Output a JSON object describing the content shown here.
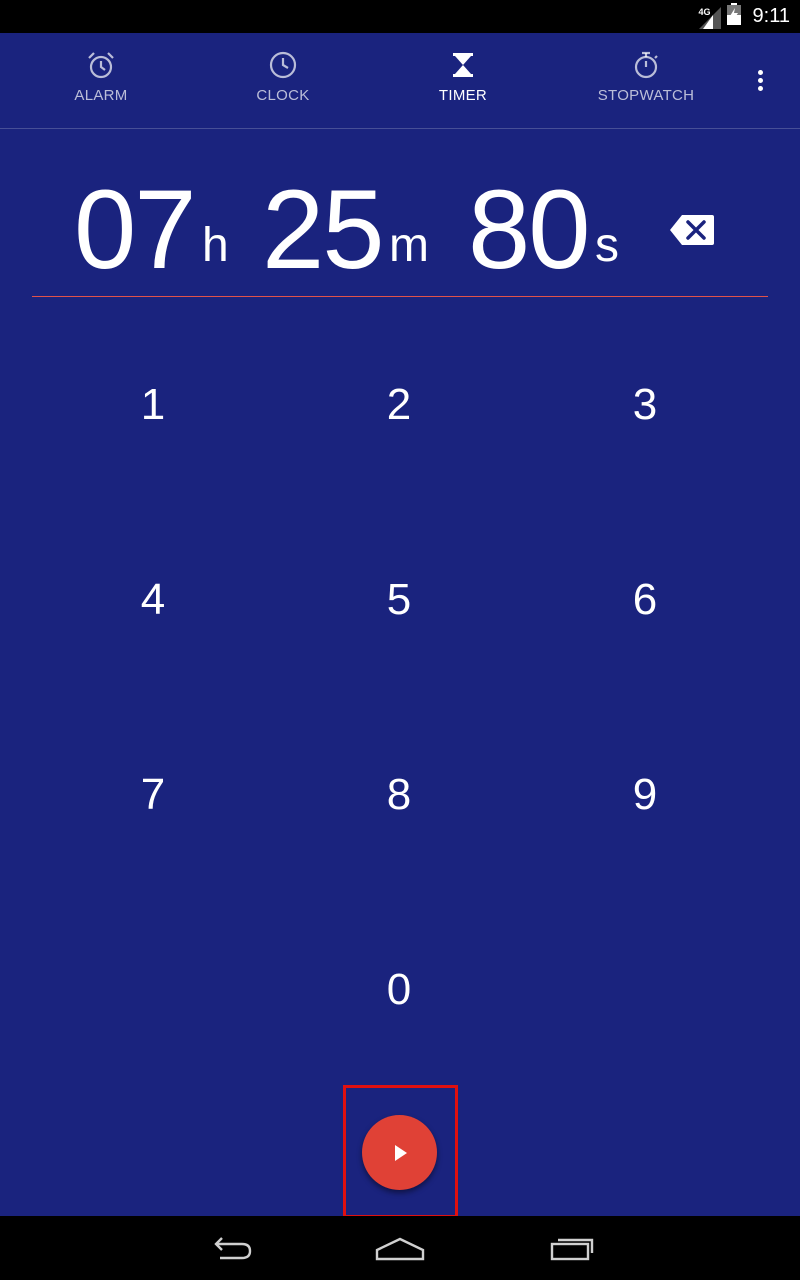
{
  "status_bar": {
    "network": "4G",
    "time": "9:11"
  },
  "tabs": [
    {
      "label": "ALARM",
      "icon": "alarm-icon",
      "active": false
    },
    {
      "label": "CLOCK",
      "icon": "clock-icon",
      "active": false
    },
    {
      "label": "TIMER",
      "icon": "hourglass-icon",
      "active": true
    },
    {
      "label": "STOPWATCH",
      "icon": "stopwatch-icon",
      "active": false
    }
  ],
  "overflow_icon": "more-vert-icon",
  "timer": {
    "hours": "07",
    "hours_unit": "h",
    "minutes": "25",
    "minutes_unit": "m",
    "seconds": "80",
    "seconds_unit": "s"
  },
  "keypad": [
    "1",
    "2",
    "3",
    "4",
    "5",
    "6",
    "7",
    "8",
    "9",
    "0"
  ],
  "start_button_icon": "play-icon",
  "colors": {
    "background": "#1a237e",
    "accent": "#e04136",
    "divider": "#e0524a",
    "highlight": "#e01010"
  }
}
